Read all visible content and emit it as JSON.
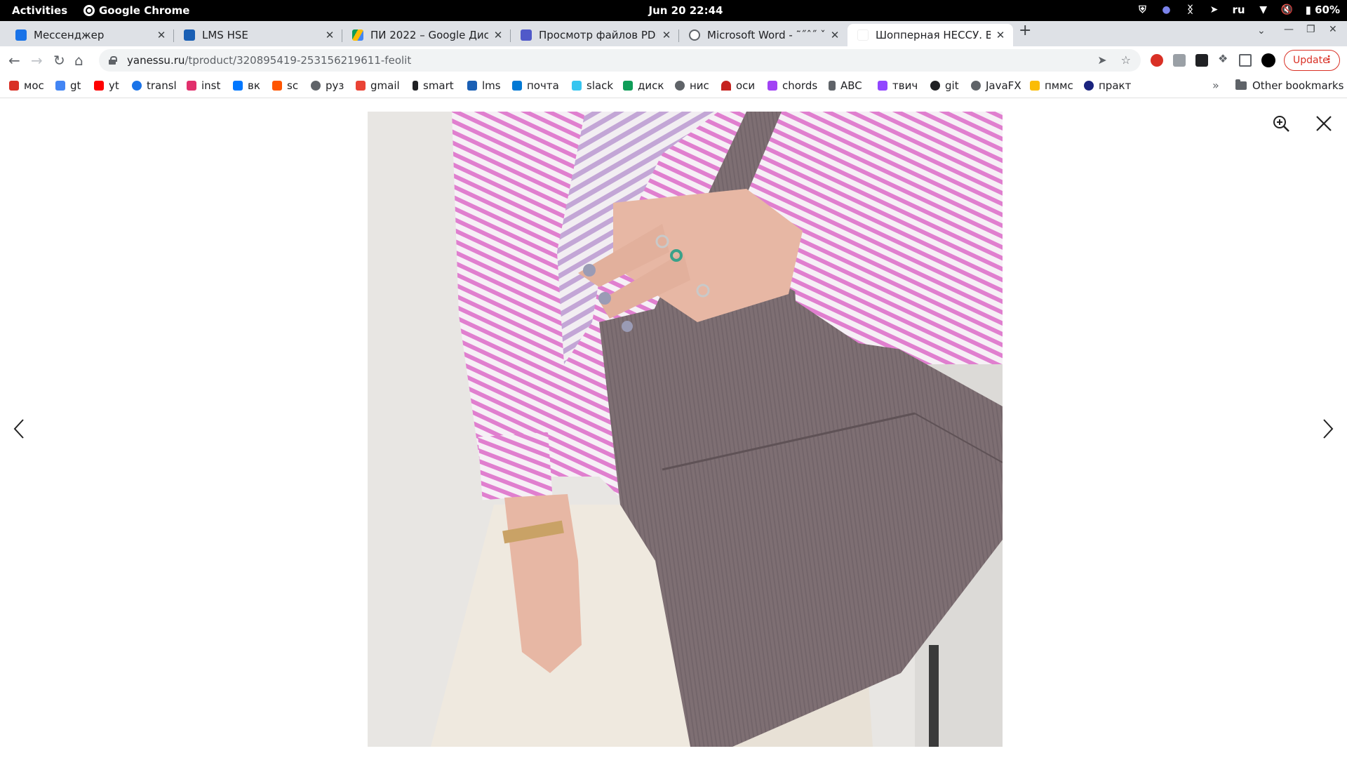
{
  "system_bar": {
    "activities": "Activities",
    "app_name": "Google Chrome",
    "clock": "Jun 20  22:44",
    "language": "ru",
    "battery": "60%"
  },
  "tabs": [
    {
      "title": "Мессенджер",
      "favicon_color": "#1a73e8"
    },
    {
      "title": "LMS HSE",
      "favicon_color": "#1a5fb4"
    },
    {
      "title": "ПИ 2022 – Google Диск",
      "favicon_color": "#fbbc04"
    },
    {
      "title": "Просмотр файлов PDF",
      "favicon_color": "#5059c9"
    },
    {
      "title": "Microsoft Word - ˜˝ˆ˝ ˇ ˛˝ ˝",
      "favicon_color": "#5f6368"
    },
    {
      "title": "Шопперная НЕССУ. Вели",
      "favicon_color": "#ffffff",
      "active": true
    }
  ],
  "toolbar": {
    "url_host": "yanessu.ru",
    "url_path": "/tproduct/320895419-253156219611-feolit",
    "update_label": "Update"
  },
  "bookmarks": [
    {
      "label": "мос",
      "color": "#d93025"
    },
    {
      "label": "gt",
      "color": "#4285f4"
    },
    {
      "label": "yt",
      "color": "#ff0000"
    },
    {
      "label": "transl",
      "color": "#1a73e8"
    },
    {
      "label": "inst",
      "color": "#e1306c"
    },
    {
      "label": "вк",
      "color": "#0077ff"
    },
    {
      "label": "sc",
      "color": "#ff5500"
    },
    {
      "label": "руз",
      "color": "#5f6368"
    },
    {
      "label": "gmail",
      "color": "#ea4335"
    },
    {
      "label": "smart",
      "color": "#202124"
    },
    {
      "label": "lms",
      "color": "#1a5fb4"
    },
    {
      "label": "почта",
      "color": "#0078d4"
    },
    {
      "label": "slack",
      "color": "#36c5f0"
    },
    {
      "label": "диск",
      "color": "#0f9d58"
    },
    {
      "label": "нис",
      "color": "#5f6368"
    },
    {
      "label": "оси",
      "color": "#c5221f"
    },
    {
      "label": "chords",
      "color": "#a142f4"
    },
    {
      "label": "ABC",
      "color": "#5f6368"
    },
    {
      "label": "твич",
      "color": "#9146ff"
    },
    {
      "label": "git",
      "color": "#202124"
    },
    {
      "label": "JavaFX",
      "color": "#5f6368"
    },
    {
      "label": "пммс",
      "color": "#fbbc04"
    },
    {
      "label": "практ",
      "color": "#1a237e"
    }
  ],
  "other_bookmarks": "Other bookmarks"
}
